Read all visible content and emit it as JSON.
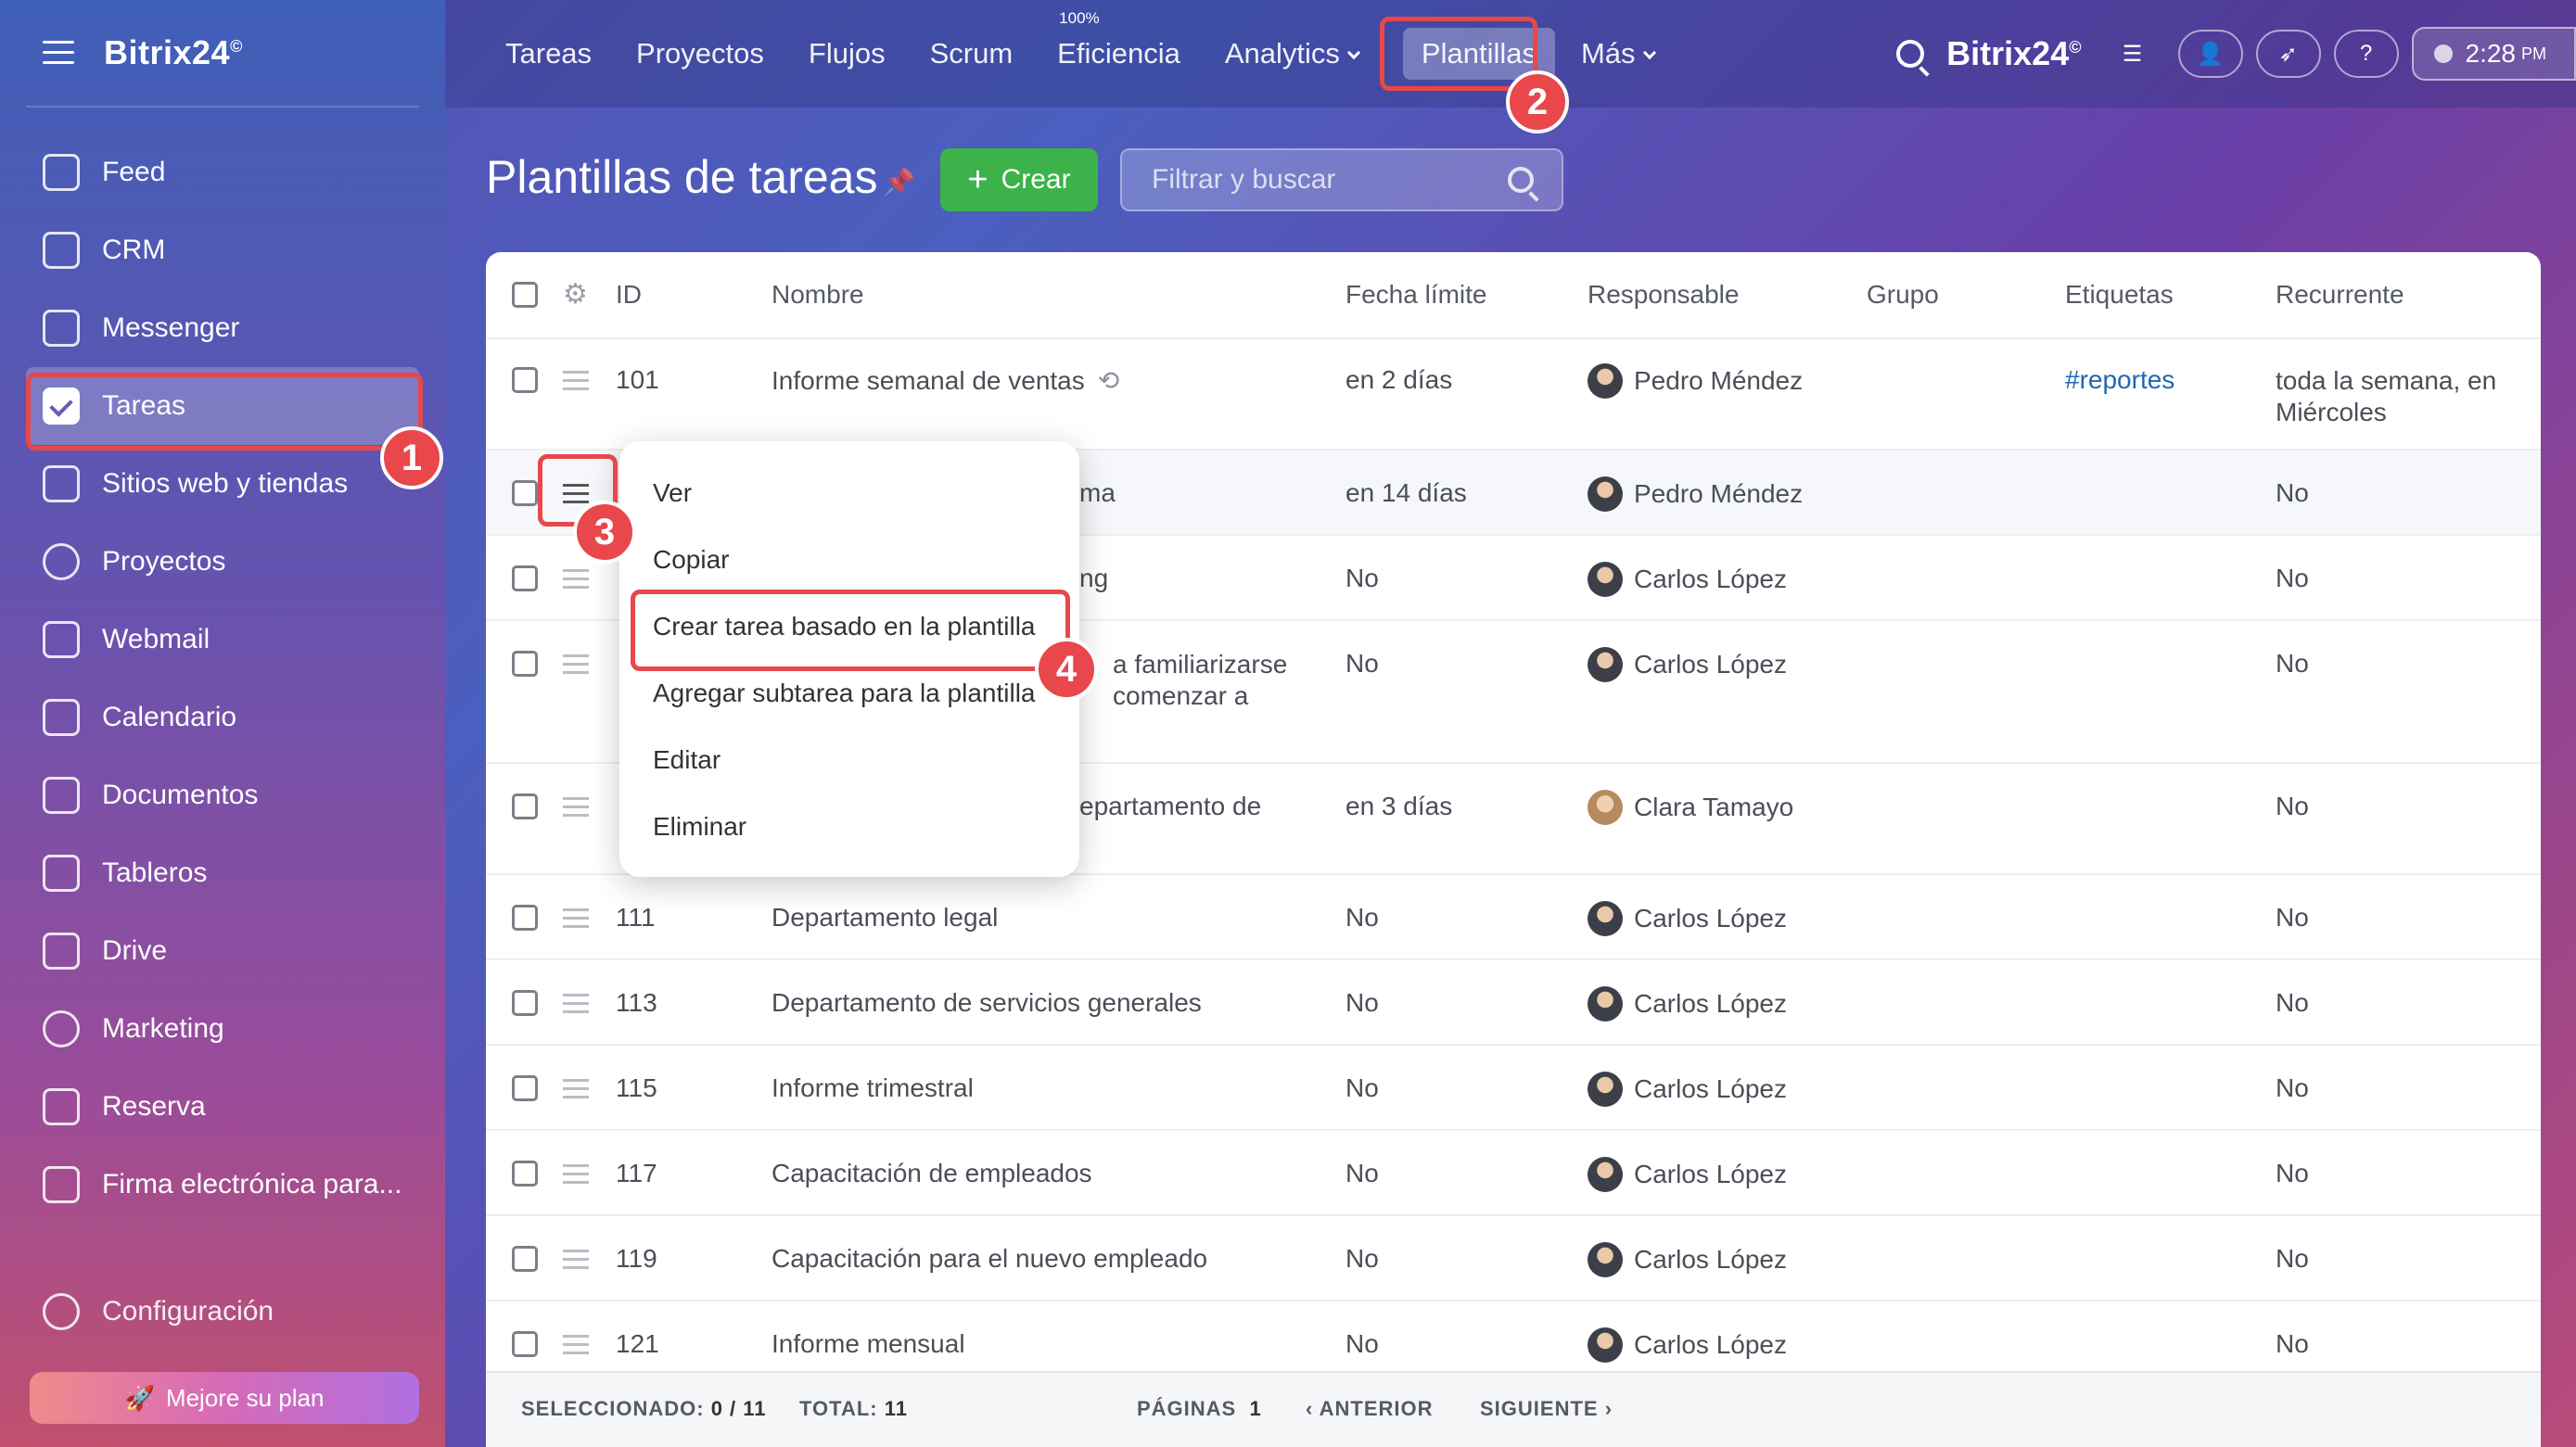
{
  "brand": {
    "name": "Bitrix24",
    "mark": "©"
  },
  "sidebar": {
    "items": [
      {
        "label": "Feed",
        "icon": "feed-icon"
      },
      {
        "label": "CRM",
        "icon": "crm-icon"
      },
      {
        "label": "Messenger",
        "icon": "messenger-icon"
      },
      {
        "label": "Tareas",
        "icon": "tasks-checkbox-icon",
        "active": true
      },
      {
        "label": "Sitios web y tiendas",
        "icon": "cart-icon"
      },
      {
        "label": "Proyectos",
        "icon": "projects-icon"
      },
      {
        "label": "Webmail",
        "icon": "mail-icon"
      },
      {
        "label": "Calendario",
        "icon": "calendar-icon"
      },
      {
        "label": "Documentos",
        "icon": "document-icon"
      },
      {
        "label": "Tableros",
        "icon": "boards-icon"
      },
      {
        "label": "Drive",
        "icon": "drive-icon"
      },
      {
        "label": "Marketing",
        "icon": "marketing-icon"
      },
      {
        "label": "Reserva",
        "icon": "booking-icon"
      },
      {
        "label": "Firma electrónica para...",
        "icon": "e-signature-icon"
      }
    ],
    "config": "Configuración",
    "upgrade": "Mejore su plan"
  },
  "topnav": {
    "items": [
      {
        "label": "Tareas"
      },
      {
        "label": "Proyectos"
      },
      {
        "label": "Flujos"
      },
      {
        "label": "Scrum"
      },
      {
        "label": "Eficiencia",
        "badge": "100%"
      },
      {
        "label": "Analytics",
        "dropdown": true
      },
      {
        "label": "Plantillas",
        "active": true
      },
      {
        "label": "Más",
        "dropdown": true
      }
    ],
    "clock": {
      "time": "2:28",
      "ampm": "PM"
    }
  },
  "page": {
    "title": "Plantillas de tareas",
    "create_label": "Crear",
    "filter_placeholder": "Filtrar y buscar"
  },
  "table": {
    "headers": {
      "id": "ID",
      "name": "Nombre",
      "deadline": "Fecha límite",
      "responsible": "Responsable",
      "group": "Grupo",
      "tags": "Etiquetas",
      "recurring": "Recurrente"
    },
    "rows": [
      {
        "id": "101",
        "name": "Informe semanal de ventas",
        "deadline": "en 2 días",
        "responsible": "Pedro Méndez",
        "tag": "#reportes",
        "recurring": "toda la semana, en Miércoles",
        "repeat_icon": true
      },
      {
        "id": "",
        "name": "ma",
        "deadline": "en 14 días",
        "responsible": "Pedro Méndez",
        "tag": "",
        "recurring": "No"
      },
      {
        "id": "",
        "name": "ng",
        "deadline": "No",
        "responsible": "Carlos López",
        "tag": "",
        "recurring": "No"
      },
      {
        "id": "",
        "name": "a familiarizarse",
        "name2": "comenzar a",
        "deadline": "No",
        "responsible": "Carlos López",
        "tag": "",
        "recurring": "No"
      },
      {
        "id": "",
        "name": "epartamento de",
        "deadline": "en 3 días",
        "responsible": "Clara Tamayo",
        "tag": "",
        "recurring": "No"
      },
      {
        "id": "111",
        "name": "Departamento legal",
        "deadline": "No",
        "responsible": "Carlos López",
        "tag": "",
        "recurring": "No"
      },
      {
        "id": "113",
        "name": "Departamento de servicios generales",
        "deadline": "No",
        "responsible": "Carlos López",
        "tag": "",
        "recurring": "No"
      },
      {
        "id": "115",
        "name": "Informe trimestral",
        "deadline": "No",
        "responsible": "Carlos López",
        "tag": "",
        "recurring": "No"
      },
      {
        "id": "117",
        "name": "Capacitación de empleados",
        "deadline": "No",
        "responsible": "Carlos López",
        "tag": "",
        "recurring": "No"
      },
      {
        "id": "119",
        "name": "Capacitación para el nuevo empleado",
        "deadline": "No",
        "responsible": "Carlos López",
        "tag": "",
        "recurring": "No"
      },
      {
        "id": "121",
        "name": "Informe mensual",
        "deadline": "No",
        "responsible": "Carlos López",
        "tag": "",
        "recurring": "No"
      }
    ],
    "footer": {
      "selected_label": "SELECCIONADO:",
      "selected_value": "0 / 11",
      "total_label": "TOTAL:",
      "total_value": "11",
      "pages_label": "PÁGINAS",
      "pages_value": "1",
      "prev": "ANTERIOR",
      "next": "SIGUIENTE"
    }
  },
  "context_menu": {
    "items": [
      "Ver",
      "Copiar",
      "Crear tarea basado en la plantilla",
      "Agregar subtarea para la plantilla",
      "Editar",
      "Eliminar"
    ]
  },
  "annotations": [
    "1",
    "2",
    "3",
    "4"
  ],
  "colors": {
    "accent_green": "#3bb34a",
    "highlight_red": "#e8474b",
    "tag_blue": "#2067b0"
  }
}
